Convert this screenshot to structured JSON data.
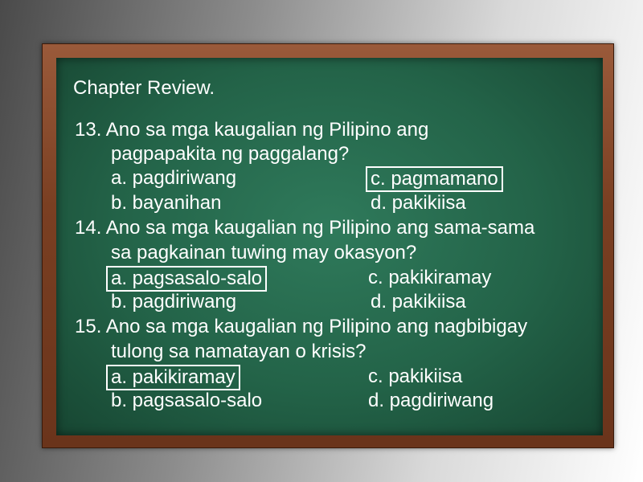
{
  "title": "Chapter Review.",
  "questions": [
    {
      "line1": "13. Ano sa mga kaugalian ng Pilipino ang",
      "line2": "pagpapakita ng paggalang?",
      "a": "a. pagdiriwang",
      "b": "b. bayanihan",
      "c": "c. pagmamano",
      "d": "d. pakikiisa",
      "answer": "c"
    },
    {
      "line1": "14. Ano sa mga kaugalian ng Pilipino ang sama-sama",
      "line2": "sa pagkainan tuwing may okasyon?",
      "a": "a. pagsasalo-salo",
      "b": "b. pagdiriwang",
      "c": "c. pakikiramay",
      "d": "d. pakikiisa",
      "answer": "a"
    },
    {
      "line1": "15. Ano sa mga kaugalian ng Pilipino ang nagbibigay",
      "line2": "tulong sa namatayan o krisis?",
      "a": "a. pakikiramay",
      "b": "b. pagsasalo-salo",
      "c": "c. pakikiisa",
      "d": "d. pagdiriwang",
      "answer": "a"
    }
  ]
}
